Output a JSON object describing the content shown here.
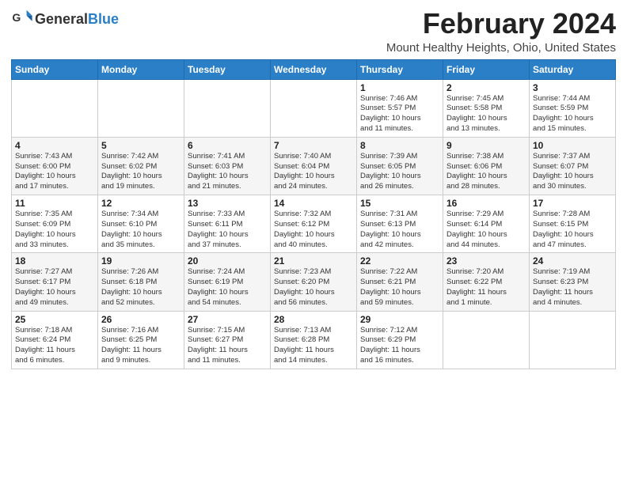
{
  "header": {
    "logo_general": "General",
    "logo_blue": "Blue",
    "month_title": "February 2024",
    "subtitle": "Mount Healthy Heights, Ohio, United States"
  },
  "days_of_week": [
    "Sunday",
    "Monday",
    "Tuesday",
    "Wednesday",
    "Thursday",
    "Friday",
    "Saturday"
  ],
  "weeks": [
    [
      {
        "day": "",
        "info": ""
      },
      {
        "day": "",
        "info": ""
      },
      {
        "day": "",
        "info": ""
      },
      {
        "day": "",
        "info": ""
      },
      {
        "day": "1",
        "info": "Sunrise: 7:46 AM\nSunset: 5:57 PM\nDaylight: 10 hours\nand 11 minutes."
      },
      {
        "day": "2",
        "info": "Sunrise: 7:45 AM\nSunset: 5:58 PM\nDaylight: 10 hours\nand 13 minutes."
      },
      {
        "day": "3",
        "info": "Sunrise: 7:44 AM\nSunset: 5:59 PM\nDaylight: 10 hours\nand 15 minutes."
      }
    ],
    [
      {
        "day": "4",
        "info": "Sunrise: 7:43 AM\nSunset: 6:00 PM\nDaylight: 10 hours\nand 17 minutes."
      },
      {
        "day": "5",
        "info": "Sunrise: 7:42 AM\nSunset: 6:02 PM\nDaylight: 10 hours\nand 19 minutes."
      },
      {
        "day": "6",
        "info": "Sunrise: 7:41 AM\nSunset: 6:03 PM\nDaylight: 10 hours\nand 21 minutes."
      },
      {
        "day": "7",
        "info": "Sunrise: 7:40 AM\nSunset: 6:04 PM\nDaylight: 10 hours\nand 24 minutes."
      },
      {
        "day": "8",
        "info": "Sunrise: 7:39 AM\nSunset: 6:05 PM\nDaylight: 10 hours\nand 26 minutes."
      },
      {
        "day": "9",
        "info": "Sunrise: 7:38 AM\nSunset: 6:06 PM\nDaylight: 10 hours\nand 28 minutes."
      },
      {
        "day": "10",
        "info": "Sunrise: 7:37 AM\nSunset: 6:07 PM\nDaylight: 10 hours\nand 30 minutes."
      }
    ],
    [
      {
        "day": "11",
        "info": "Sunrise: 7:35 AM\nSunset: 6:09 PM\nDaylight: 10 hours\nand 33 minutes."
      },
      {
        "day": "12",
        "info": "Sunrise: 7:34 AM\nSunset: 6:10 PM\nDaylight: 10 hours\nand 35 minutes."
      },
      {
        "day": "13",
        "info": "Sunrise: 7:33 AM\nSunset: 6:11 PM\nDaylight: 10 hours\nand 37 minutes."
      },
      {
        "day": "14",
        "info": "Sunrise: 7:32 AM\nSunset: 6:12 PM\nDaylight: 10 hours\nand 40 minutes."
      },
      {
        "day": "15",
        "info": "Sunrise: 7:31 AM\nSunset: 6:13 PM\nDaylight: 10 hours\nand 42 minutes."
      },
      {
        "day": "16",
        "info": "Sunrise: 7:29 AM\nSunset: 6:14 PM\nDaylight: 10 hours\nand 44 minutes."
      },
      {
        "day": "17",
        "info": "Sunrise: 7:28 AM\nSunset: 6:15 PM\nDaylight: 10 hours\nand 47 minutes."
      }
    ],
    [
      {
        "day": "18",
        "info": "Sunrise: 7:27 AM\nSunset: 6:17 PM\nDaylight: 10 hours\nand 49 minutes."
      },
      {
        "day": "19",
        "info": "Sunrise: 7:26 AM\nSunset: 6:18 PM\nDaylight: 10 hours\nand 52 minutes."
      },
      {
        "day": "20",
        "info": "Sunrise: 7:24 AM\nSunset: 6:19 PM\nDaylight: 10 hours\nand 54 minutes."
      },
      {
        "day": "21",
        "info": "Sunrise: 7:23 AM\nSunset: 6:20 PM\nDaylight: 10 hours\nand 56 minutes."
      },
      {
        "day": "22",
        "info": "Sunrise: 7:22 AM\nSunset: 6:21 PM\nDaylight: 10 hours\nand 59 minutes."
      },
      {
        "day": "23",
        "info": "Sunrise: 7:20 AM\nSunset: 6:22 PM\nDaylight: 11 hours\nand 1 minute."
      },
      {
        "day": "24",
        "info": "Sunrise: 7:19 AM\nSunset: 6:23 PM\nDaylight: 11 hours\nand 4 minutes."
      }
    ],
    [
      {
        "day": "25",
        "info": "Sunrise: 7:18 AM\nSunset: 6:24 PM\nDaylight: 11 hours\nand 6 minutes."
      },
      {
        "day": "26",
        "info": "Sunrise: 7:16 AM\nSunset: 6:25 PM\nDaylight: 11 hours\nand 9 minutes."
      },
      {
        "day": "27",
        "info": "Sunrise: 7:15 AM\nSunset: 6:27 PM\nDaylight: 11 hours\nand 11 minutes."
      },
      {
        "day": "28",
        "info": "Sunrise: 7:13 AM\nSunset: 6:28 PM\nDaylight: 11 hours\nand 14 minutes."
      },
      {
        "day": "29",
        "info": "Sunrise: 7:12 AM\nSunset: 6:29 PM\nDaylight: 11 hours\nand 16 minutes."
      },
      {
        "day": "",
        "info": ""
      },
      {
        "day": "",
        "info": ""
      }
    ]
  ]
}
